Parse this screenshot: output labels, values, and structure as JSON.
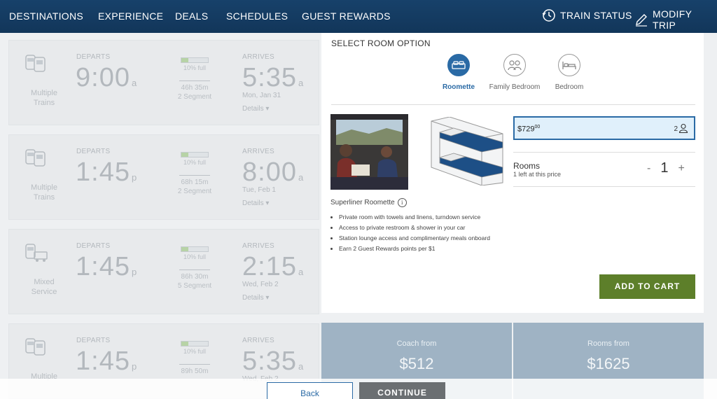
{
  "nav": {
    "items": [
      "DESTINATIONS",
      "EXPERIENCE",
      "DEALS",
      "SCHEDULES",
      "GUEST REWARDS"
    ],
    "train_status": "TRAIN STATUS",
    "modify_trip": "MODIFY TRIP",
    "icons": {
      "train_status": "clock-history-icon",
      "modify_trip": "pencil-icon"
    }
  },
  "trips": [
    {
      "type": "Multiple Trains",
      "departs_label": "DEPARTS",
      "depart": "9:00",
      "depart_ampm": "a",
      "capacity": "10% full",
      "duration": "46h 35m",
      "segments": "2 Segment",
      "arrives_label": "ARRIVES",
      "arrive": "5:35",
      "arrive_ampm": "a",
      "arrive_date": "Mon, Jan 31",
      "details": "Details"
    },
    {
      "type": "Multiple Trains",
      "departs_label": "DEPARTS",
      "depart": "1:45",
      "depart_ampm": "p",
      "capacity": "10% full",
      "duration": "68h 15m",
      "segments": "2 Segment",
      "arrives_label": "ARRIVES",
      "arrive": "8:00",
      "arrive_ampm": "a",
      "arrive_date": "Tue, Feb 1",
      "details": "Details"
    },
    {
      "type": "Mixed Service",
      "departs_label": "DEPARTS",
      "depart": "1:45",
      "depart_ampm": "p",
      "capacity": "10% full",
      "duration": "86h 30m",
      "segments": "5 Segment",
      "arrives_label": "ARRIVES",
      "arrive": "2:15",
      "arrive_ampm": "a",
      "arrive_date": "Wed, Feb 2",
      "details": "Details"
    },
    {
      "type": "Multiple",
      "departs_label": "DEPARTS",
      "depart": "1:45",
      "depart_ampm": "p",
      "capacity": "10% full",
      "duration": "89h 50m",
      "segments": "",
      "arrives_label": "ARRIVES",
      "arrive": "5:35",
      "arrive_ampm": "a",
      "arrive_date": "Wed, Feb 2",
      "details": ""
    }
  ],
  "room": {
    "title": "SELECT ROOM OPTION",
    "options": [
      {
        "label": "Roomette",
        "icon": "roomette-bed-icon",
        "active": true
      },
      {
        "label": "Family Bedroom",
        "icon": "family-people-icon",
        "active": false
      },
      {
        "label": "Bedroom",
        "icon": "bedroom-bed-icon",
        "active": false
      }
    ],
    "price": "$729",
    "price_cents": "00",
    "guests": "2",
    "rooms_label": "Rooms",
    "rooms_sub": "1 left at this price",
    "minus": "-",
    "quantity": "1",
    "plus": "+",
    "name": "Superliner Roomette",
    "info": "i",
    "features": [
      "Private room with towels and linens, turndown service",
      "Access to private restroom & shower in your car",
      "Station lounge access and complimentary meals onboard",
      "Earn 2 Guest Rewards points per $1"
    ],
    "add_to_cart": "ADD TO CART"
  },
  "fares": {
    "coach_label": "Coach from",
    "coach_price": "$512",
    "rooms_label": "Rooms from",
    "rooms_price": "$1625"
  },
  "actions": {
    "back": "Back",
    "continue": "CONTINUE"
  },
  "colors": {
    "nav": "#17416a",
    "accent": "#2a6aa5",
    "add_to_cart": "#5d7f2a",
    "fare_box": "#9fb3c4"
  }
}
